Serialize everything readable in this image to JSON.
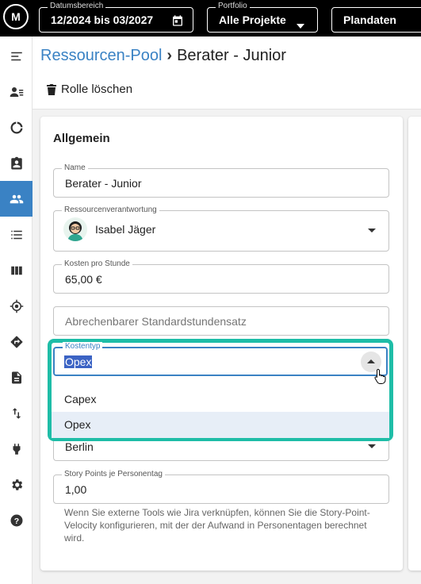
{
  "topbar": {
    "logo_text": "M",
    "date_range": {
      "label": "Datumsbereich",
      "value": "12/2024 bis 03/2027",
      "icon": "calendar-icon"
    },
    "portfolio": {
      "label": "Portfolio",
      "value": "Alle Projekte",
      "icon": "chevron-down-icon"
    },
    "view": {
      "value": "Plandaten",
      "icon": "chevron-down-icon"
    }
  },
  "sidebar": {
    "active_index": 4,
    "accent_color": "#3a82c4",
    "items": [
      {
        "name": "menu-toggle",
        "icon": "menu-icon"
      },
      {
        "name": "contacts",
        "icon": "person-list-icon"
      },
      {
        "name": "dashboard",
        "icon": "donut-chart-icon"
      },
      {
        "name": "assignments",
        "icon": "clipboard-user-icon"
      },
      {
        "name": "resource-pool",
        "icon": "people-icon"
      },
      {
        "name": "list",
        "icon": "list-icon"
      },
      {
        "name": "boards",
        "icon": "columns-icon"
      },
      {
        "name": "targets",
        "icon": "crosshair-icon"
      },
      {
        "name": "routing",
        "icon": "diamond-arrow-icon"
      },
      {
        "name": "documents",
        "icon": "document-icon"
      },
      {
        "name": "transfers",
        "icon": "swap-icon"
      },
      {
        "name": "integrations",
        "icon": "plug-icon"
      },
      {
        "name": "settings",
        "icon": "gear-icon"
      },
      {
        "name": "help",
        "icon": "help-icon"
      }
    ]
  },
  "header": {
    "breadcrumb_parent": "Ressourcen-Pool",
    "breadcrumb_separator": "›",
    "breadcrumb_current": "Berater - Junior",
    "delete_label": "Rolle löschen"
  },
  "form": {
    "section_title": "Allgemein",
    "name": {
      "label": "Name",
      "value": "Berater - Junior"
    },
    "owner": {
      "label": "Ressourcenverantwortung",
      "value": "Isabel Jäger"
    },
    "cost": {
      "label": "Kosten pro Stunde",
      "value": "65,00 €"
    },
    "billable": {
      "placeholder": "Abrechenbarer Standardstundensatz"
    },
    "cost_type": {
      "label": "Kostentyp",
      "value": "Opex",
      "options": [
        "Capex",
        "Opex"
      ],
      "highlight_color": "#1ebda7"
    },
    "location": {
      "value": "Berlin"
    },
    "story_points": {
      "label": "Story Points je Personentag",
      "value": "1,00"
    },
    "helper_text": "Wenn Sie externe Tools wie Jira verknüpfen, können Sie die Story-Point-Velocity konfigurieren, mit der der Aufwand in Personentagen berechnet wird."
  }
}
